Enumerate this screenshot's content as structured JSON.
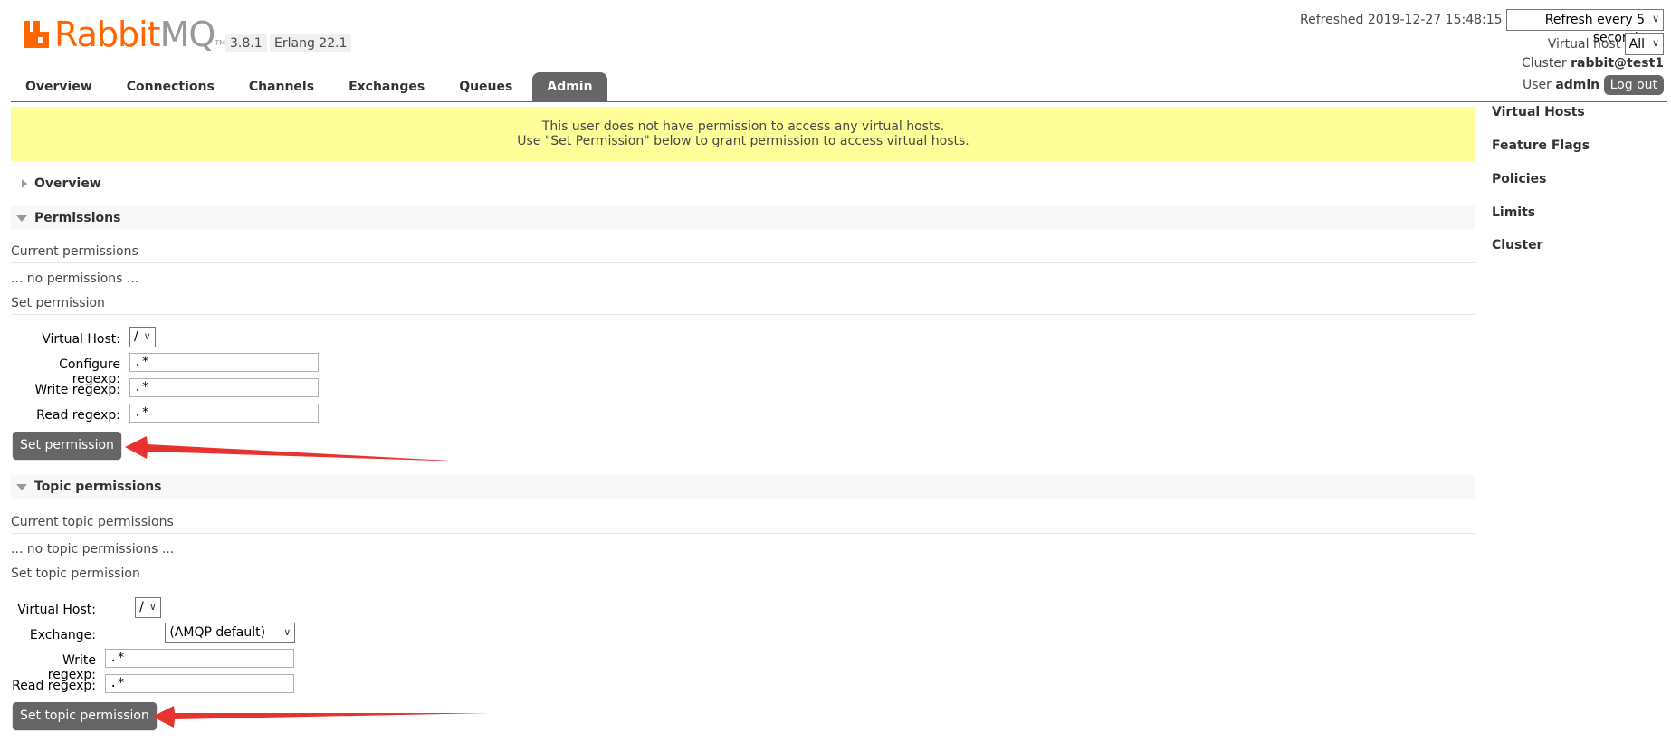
{
  "logo": {
    "rabbit": "Rabbit",
    "mq": "MQ",
    "tm": "TM"
  },
  "version": "3.8.1",
  "erlang": "Erlang 22.1",
  "header": {
    "refreshed_label": "Refreshed 2019-12-27 15:48:15",
    "refresh_select": "Refresh every 5 seconds",
    "vhost_label": "Virtual host",
    "vhost_select": "All",
    "cluster_label": "Cluster",
    "cluster_value": "rabbit@test1",
    "user_label": "User",
    "user_value": "admin",
    "logout": "Log out"
  },
  "tabs": [
    "Overview",
    "Connections",
    "Channels",
    "Exchanges",
    "Queues",
    "Admin"
  ],
  "active_tab": "Admin",
  "right_nav": [
    "Virtual Hosts",
    "Feature Flags",
    "Policies",
    "Limits",
    "Cluster"
  ],
  "warning": {
    "line1": "This user does not have permission to access any virtual hosts.",
    "line2": "Use \"Set Permission\" below to grant permission to access virtual hosts."
  },
  "overview_section": "Overview",
  "permissions": {
    "title": "Permissions",
    "current": "Current permissions",
    "none": "... no permissions ...",
    "set": "Set permission",
    "vhost_label": "Virtual Host:",
    "vhost_value": "/",
    "configure_label": "Configure regexp:",
    "configure_value": ".*",
    "write_label": "Write regexp:",
    "write_value": ".*",
    "read_label": "Read regexp:",
    "read_value": ".*",
    "button": "Set permission"
  },
  "topic": {
    "title": "Topic permissions",
    "current": "Current topic permissions",
    "none": "... no topic permissions ...",
    "set": "Set topic permission",
    "vhost_label": "Virtual Host:",
    "vhost_value": "/",
    "exchange_label": "Exchange:",
    "exchange_value": "(AMQP default)",
    "write_label": "Write regexp:",
    "write_value": ".*",
    "read_label": "Read regexp:",
    "read_value": ".*",
    "button": "Set topic permission"
  },
  "colors": {
    "accent": "#ff6600",
    "annotation_arrow": "#e8322d",
    "tab_active": "#666666",
    "warning_bg": "#ffff99"
  }
}
